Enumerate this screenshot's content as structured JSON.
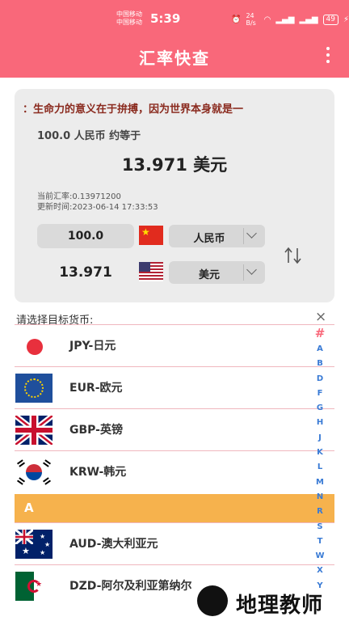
{
  "status_bar": {
    "carrier1": "中国移动",
    "carrier2": "中国移动",
    "time": "5:39",
    "speed": "24 B/s",
    "battery": "49"
  },
  "header": {
    "title": "汇率快查"
  },
  "card": {
    "marquee": "：生命力的意义在于拚搏，因为世界本身就是一",
    "equal_line": "100.0 人民币 约等于",
    "result": "13.971 美元",
    "rate": "当前汇率:0.13971200",
    "updated": "更新时间:2023-06-14 17:33:53",
    "from": {
      "amount": "100.0",
      "currency": "人民币",
      "flag_icon": "china-flag-icon"
    },
    "to": {
      "amount": "13.971",
      "currency": "美元",
      "flag_icon": "usa-flag-icon"
    }
  },
  "picker": {
    "prompt": "请选择目标货币:",
    "close": "×",
    "rows": [
      {
        "name": "JPY-日元",
        "flag_icon": "japan-flag-icon"
      },
      {
        "name": "EUR-欧元",
        "flag_icon": "eu-flag-icon"
      },
      {
        "name": "GBP-英镑",
        "flag_icon": "uk-flag-icon"
      },
      {
        "name": "KRW-韩元",
        "flag_icon": "korea-flag-icon"
      },
      {
        "name": "AUD-澳大利亚元",
        "flag_icon": "australia-flag-icon"
      },
      {
        "name": "DZD-阿尔及利亚第纳尔",
        "flag_icon": "algeria-flag-icon"
      }
    ],
    "section": "A",
    "index_hash": "#",
    "index_letters": [
      "A",
      "B",
      "D",
      "F",
      "G",
      "H",
      "J",
      "K",
      "L",
      "M",
      "N",
      "R",
      "S",
      "T",
      "W",
      "X",
      "Y"
    ]
  },
  "watermark": {
    "text": "地理教师"
  },
  "colors": {
    "brand": "#f9687a",
    "section_header": "#f6b24d",
    "index_letter": "#3a7bd5",
    "card_bg": "#ececec"
  }
}
